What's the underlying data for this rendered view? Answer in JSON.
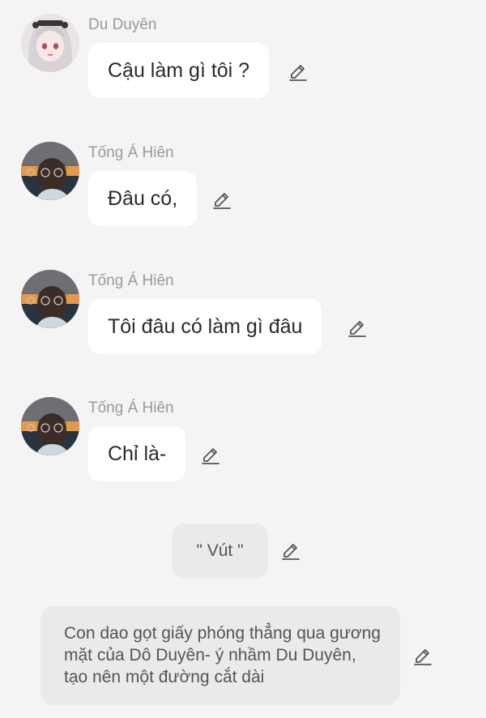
{
  "messages": [
    {
      "sender": "Du Duyên",
      "text": "Cậu làm gì tôi ?",
      "avatar": "girl-avatar"
    },
    {
      "sender": "Tống Á Hiên",
      "text": "Đâu có,",
      "avatar": "boy-avatar"
    },
    {
      "sender": "Tống Á Hiên",
      "text": "Tôi đâu có làm gì đâu",
      "avatar": "boy-avatar"
    },
    {
      "sender": "Tống Á Hiên",
      "text": "Chỉ là-",
      "avatar": "boy-avatar"
    }
  ],
  "narration": [
    {
      "text": "\" Vút \""
    },
    {
      "text": "Con dao gọt giấy phóng thẳng qua gương mặt của Dô Duyên- ý nhầm Du Duyên, tạo nên một đường cắt dài"
    }
  ],
  "icons": {
    "edit": "pencil-edit-icon"
  },
  "colors": {
    "background": "#f4f4f4",
    "bubble": "#ffffff",
    "narration_bubble": "#eaeaea",
    "sender": "#9a9a9a",
    "text": "#2b2b2b"
  }
}
